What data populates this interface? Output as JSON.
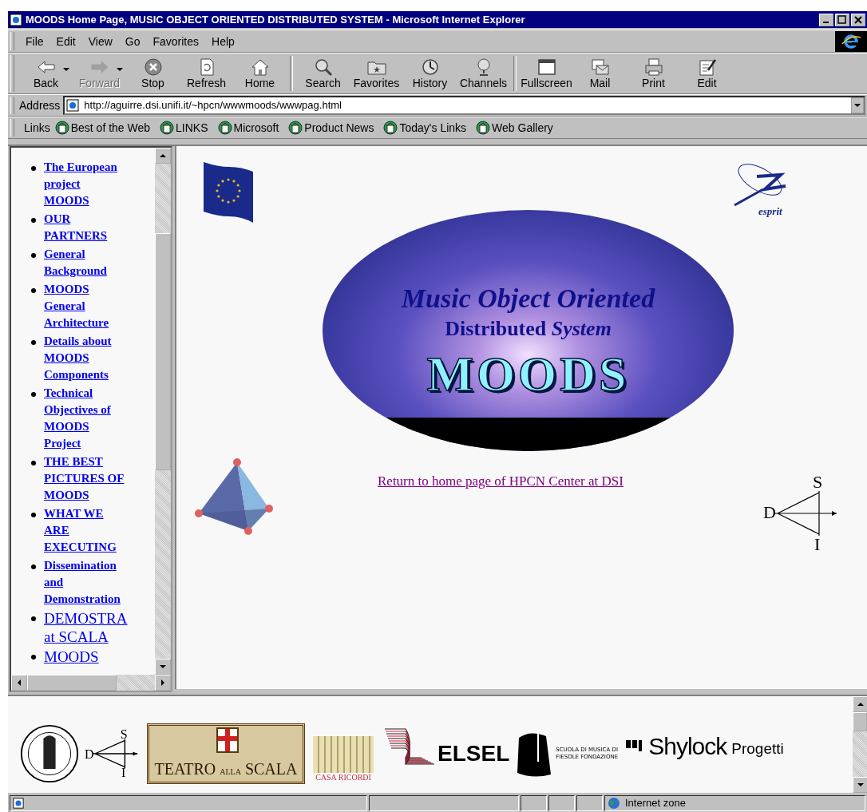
{
  "window": {
    "title": "MOODS Home Page, MUSIC OBJECT ORIENTED DISTRIBUTED SYSTEM - Microsoft Internet Explorer"
  },
  "menu": [
    "File",
    "Edit",
    "View",
    "Go",
    "Favorites",
    "Help"
  ],
  "toolbar": [
    {
      "kind": "back",
      "label": "Back",
      "disabled": false,
      "has_menu": true
    },
    {
      "kind": "forward",
      "label": "Forward",
      "disabled": true,
      "has_menu": true
    },
    {
      "kind": "stop",
      "label": "Stop",
      "disabled": false,
      "has_menu": false
    },
    {
      "kind": "refresh",
      "label": "Refresh",
      "disabled": false,
      "has_menu": false
    },
    {
      "kind": "home",
      "label": "Home",
      "disabled": false,
      "has_menu": false
    },
    {
      "kind": "separator"
    },
    {
      "kind": "search",
      "label": "Search",
      "disabled": false,
      "has_menu": false
    },
    {
      "kind": "favorites",
      "label": "Favorites",
      "disabled": false,
      "has_menu": false
    },
    {
      "kind": "history",
      "label": "History",
      "disabled": false,
      "has_menu": false
    },
    {
      "kind": "channels",
      "label": "Channels",
      "disabled": false,
      "has_menu": false
    },
    {
      "kind": "separator"
    },
    {
      "kind": "fullscreen",
      "label": "Fullscreen",
      "disabled": false,
      "has_menu": false
    },
    {
      "kind": "mail",
      "label": "Mail",
      "disabled": false,
      "has_menu": false
    },
    {
      "kind": "print",
      "label": "Print",
      "disabled": false,
      "has_menu": false
    },
    {
      "kind": "edit",
      "label": "Edit",
      "disabled": false,
      "has_menu": false
    }
  ],
  "address": {
    "label": "Address",
    "url": "http://aguirre.dsi.unifi.it/~hpcn/wwwmoods/wwwpag.html"
  },
  "links_bar": {
    "label": "Links",
    "items": [
      "Best of the Web",
      "LINKS",
      "Microsoft",
      "Product News",
      "Today's Links",
      "Web Gallery"
    ]
  },
  "nav_frame": {
    "items": [
      {
        "text": "The European project MOODS",
        "kind": "small"
      },
      {
        "text": "OUR PARTNERS",
        "kind": "small"
      },
      {
        "text": "General Background",
        "kind": "small"
      },
      {
        "text": "MOODS General Architecture",
        "kind": "small"
      },
      {
        "text": "Details about MOODS Components",
        "kind": "small"
      },
      {
        "text": "Technical Objectives of MOODS Project",
        "kind": "small"
      },
      {
        "text": "THE BEST PICTURES OF MOODS",
        "kind": "small"
      },
      {
        "text": "WHAT WE ARE EXECUTING",
        "kind": "small"
      },
      {
        "text": "Dissemination and Demonstration",
        "kind": "small"
      },
      {
        "text": "DEMOSTRA at SCALA",
        "kind": "large"
      },
      {
        "text": "MOODS",
        "kind": "large"
      }
    ]
  },
  "main_frame": {
    "esprit_logo": "esprit",
    "banner": {
      "line_1": "Music Object Oriented",
      "line_2": "Distributed",
      "line_2b": "System",
      "title": "MOODS"
    },
    "home_link": "Return to home page of HPCN Center at DSI",
    "diagram": {
      "top": "S",
      "left": "D",
      "bottom": "I"
    }
  },
  "partner_frame": {
    "diagram": {
      "top": "S",
      "left": "D",
      "bottom": "I"
    },
    "scala": "TEATRO",
    "scala_mid": "ALLA",
    "scala_end": "SCALA",
    "ricordi": "CASA RICORDI",
    "elsel": "ELSEL",
    "scuola": "SCUOLA DI MUSICA DI FIESOLE FONDAZIONE",
    "shylock": "Shylock",
    "shylock_sub": "Progetti"
  },
  "status_bar": {
    "zone": "Internet zone"
  }
}
